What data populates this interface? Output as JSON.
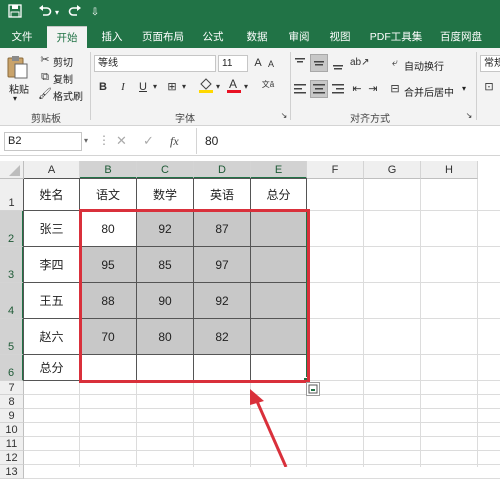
{
  "qat": {
    "save_icon": "save-icon",
    "undo_icon": "undo-icon",
    "redo_icon": "redo-icon"
  },
  "tabs": [
    "文件",
    "开始",
    "插入",
    "页面布局",
    "公式",
    "数据",
    "审阅",
    "视图",
    "PDF工具集",
    "百度网盘"
  ],
  "active_tab": "开始",
  "ribbon": {
    "paste_label": "粘贴",
    "cut_label": "剪切",
    "copy_label": "复制",
    "format_painter_label": "格式刷",
    "clipboard_group": "剪贴板",
    "font_name": "等线",
    "font_size": "11",
    "bold": "B",
    "italic": "I",
    "underline": "U",
    "font_group": "字体",
    "wrap_text": "自动换行",
    "merge_center": "合并后居中",
    "alignment_group": "对齐方式",
    "number_format": "常规"
  },
  "formula_bar": {
    "name_box": "B2",
    "fx": "fx",
    "value": "80"
  },
  "sheet": {
    "columns": [
      "A",
      "B",
      "C",
      "D",
      "E",
      "F",
      "G",
      "H"
    ],
    "selected_columns": [
      "B",
      "C",
      "D",
      "E"
    ],
    "rows": [
      "1",
      "2",
      "3",
      "4",
      "5",
      "6",
      "7",
      "8",
      "9",
      "10",
      "11",
      "12",
      "13"
    ],
    "selected_rows": [
      "2",
      "3",
      "4",
      "5",
      "6"
    ],
    "headers": [
      "姓名",
      "语文",
      "数学",
      "英语",
      "总分"
    ],
    "data": [
      [
        "张三",
        "80",
        "92",
        "87",
        ""
      ],
      [
        "李四",
        "95",
        "85",
        "97",
        ""
      ],
      [
        "王五",
        "88",
        "90",
        "92",
        ""
      ],
      [
        "赵六",
        "70",
        "80",
        "82",
        ""
      ],
      [
        "总分",
        "",
        "",
        "",
        ""
      ]
    ]
  },
  "colors": {
    "excel_green": "#217346",
    "selection_fill": "#c8c8c8",
    "highlight_border": "#d9303b",
    "arrow": "#d9303b"
  }
}
